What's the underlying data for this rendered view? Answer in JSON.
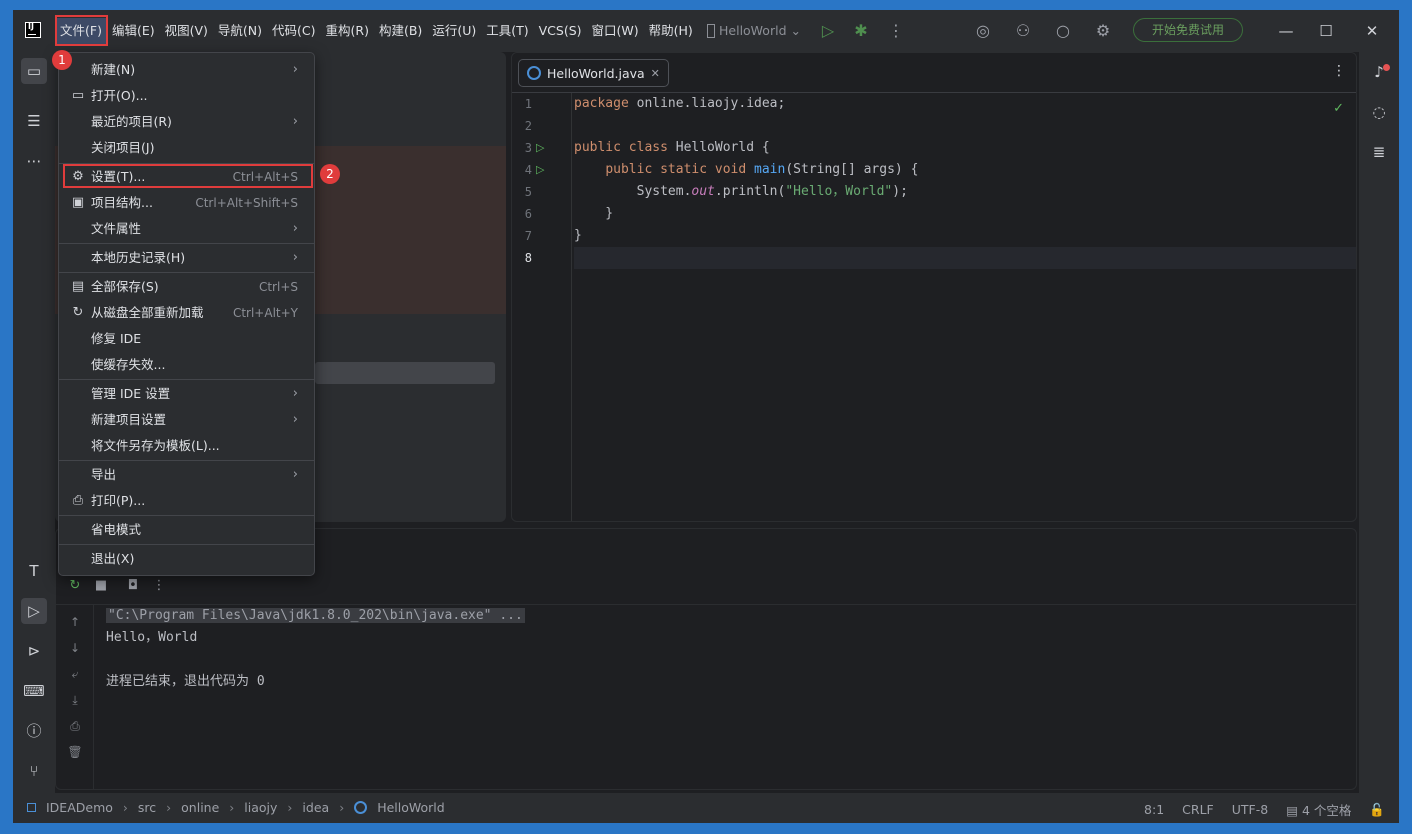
{
  "menubar": {
    "items": [
      "文件(F)",
      "编辑(E)",
      "视图(V)",
      "导航(N)",
      "代码(C)",
      "重构(R)",
      "构建(B)",
      "运行(U)",
      "工具(T)",
      "VCS(S)",
      "窗口(W)",
      "帮助(H)"
    ]
  },
  "titlebar": {
    "project": "HelloWorld",
    "trial_label": "开始免费试用"
  },
  "file_menu": {
    "items": [
      {
        "label": "新建(N)",
        "shortcut": "",
        "submenu": "›",
        "icon": ""
      },
      {
        "label": "打开(O)...",
        "shortcut": "",
        "submenu": "",
        "icon": "folder-icon"
      },
      {
        "label": "最近的项目(R)",
        "shortcut": "",
        "submenu": "›",
        "icon": ""
      },
      {
        "label": "关闭项目(J)",
        "shortcut": "",
        "submenu": "",
        "icon": ""
      },
      {
        "label": "设置(T)...",
        "shortcut": "Ctrl+Alt+S",
        "submenu": "",
        "icon": "gear-icon"
      },
      {
        "label": "项目结构...",
        "shortcut": "Ctrl+Alt+Shift+S",
        "submenu": "",
        "icon": "project-structure-icon"
      },
      {
        "label": "文件属性",
        "shortcut": "",
        "submenu": "›",
        "icon": ""
      },
      {
        "label": "本地历史记录(H)",
        "shortcut": "",
        "submenu": "›",
        "icon": ""
      },
      {
        "label": "全部保存(S)",
        "shortcut": "Ctrl+S",
        "submenu": "",
        "icon": "save-icon"
      },
      {
        "label": "从磁盘全部重新加载",
        "shortcut": "Ctrl+Alt+Y",
        "submenu": "",
        "icon": "reload-icon"
      },
      {
        "label": "修复 IDE",
        "shortcut": "",
        "submenu": "",
        "icon": ""
      },
      {
        "label": "使缓存失效...",
        "shortcut": "",
        "submenu": "",
        "icon": ""
      },
      {
        "label": "管理 IDE 设置",
        "shortcut": "",
        "submenu": "›",
        "icon": ""
      },
      {
        "label": "新建项目设置",
        "shortcut": "",
        "submenu": "›",
        "icon": ""
      },
      {
        "label": "将文件另存为模板(L)...",
        "shortcut": "",
        "submenu": "",
        "icon": ""
      },
      {
        "label": "导出",
        "shortcut": "",
        "submenu": "›",
        "icon": ""
      },
      {
        "label": "打印(P)...",
        "shortcut": "",
        "submenu": "",
        "icon": "print-icon"
      },
      {
        "label": "省电模式",
        "shortcut": "",
        "submenu": "",
        "icon": ""
      },
      {
        "label": "退出(X)",
        "shortcut": "",
        "submenu": "",
        "icon": ""
      }
    ]
  },
  "annotations": {
    "badge1": "1",
    "badge2": "2"
  },
  "editor": {
    "tab_label": "HelloWorld.java",
    "line_numbers": [
      "1",
      "2",
      "3",
      "4",
      "5",
      "6",
      "7",
      "8"
    ],
    "code": {
      "l1_kw": "package",
      "l1_rest": " online.liaojy.idea;",
      "l3_kw": "public class",
      "l3_rest": " HelloWorld {",
      "l4_indent": "    ",
      "l4_kw": "public static void",
      "l4_sp": " ",
      "l4_fn": "main",
      "l4_rest": "(String[] args) {",
      "l5_a": "        System.",
      "l5_fld": "out",
      "l5_b": ".println(",
      "l5_str": "\"Hello，World\"",
      "l5_c": ");",
      "l6": "    }",
      "l7": "}"
    }
  },
  "console": {
    "cmd": "\"C:\\Program Files\\Java\\jdk1.8.0_202\\bin\\java.exe\" ...",
    "out1": "Hello，World",
    "out2": "进程已结束，退出代码为 0"
  },
  "statusbar": {
    "breadcrumbs": [
      "IDEADemo",
      "src",
      "online",
      "liaojy",
      "idea",
      "HelloWorld"
    ],
    "position": "8:1",
    "line_sep": "CRLF",
    "encoding": "UTF-8",
    "indent": "4 个空格"
  },
  "colors": {
    "accent_red": "#e03c3c",
    "run_green": "#5fb85f",
    "java_blue": "#4a8fd6"
  }
}
